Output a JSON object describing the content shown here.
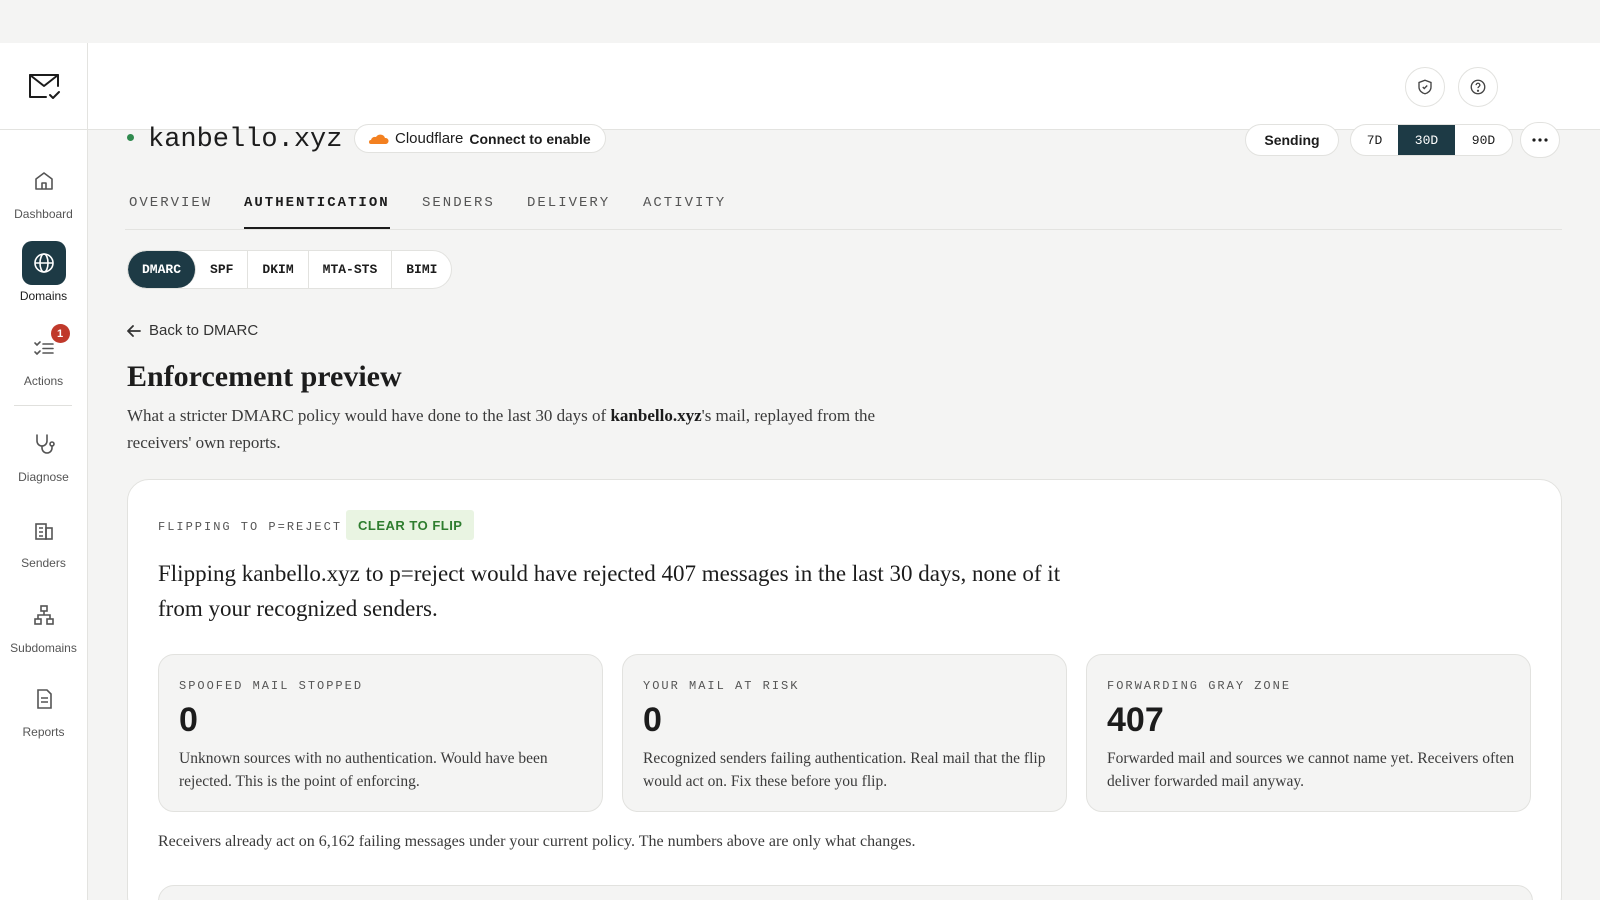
{
  "sidebar": {
    "items": [
      {
        "label": "Dashboard",
        "icon": "home-icon"
      },
      {
        "label": "Domains",
        "icon": "globe-icon"
      },
      {
        "label": "Actions",
        "icon": "checklist-icon",
        "badge": "1"
      },
      {
        "label": "Diagnose",
        "icon": "stethoscope-icon"
      },
      {
        "label": "Senders",
        "icon": "building-icon"
      },
      {
        "label": "Subdomains",
        "icon": "hierarchy-icon"
      },
      {
        "label": "Reports",
        "icon": "document-icon"
      }
    ],
    "active": "Domains"
  },
  "domain": {
    "name": "kanbello.xyz",
    "provider": "Cloudflare",
    "provider_cta": "Connect to enable",
    "status": "Sending",
    "ranges": [
      "7D",
      "30D",
      "90D"
    ],
    "active_range": "30D"
  },
  "tabs": [
    "OVERVIEW",
    "AUTHENTICATION",
    "SENDERS",
    "DELIVERY",
    "ACTIVITY"
  ],
  "active_tab": "AUTHENTICATION",
  "subtabs": [
    "DMARC",
    "SPF",
    "DKIM",
    "MTA-STS",
    "BIMI"
  ],
  "active_subtab": "DMARC",
  "page": {
    "back_label": "Back to DMARC",
    "title": "Enforcement preview",
    "intro_before": "What a stricter DMARC policy would have done to the last 30 days of ",
    "intro_domain": "kanbello.xyz",
    "intro_after": "'s mail, replayed from the receivers' own reports."
  },
  "preview": {
    "eyebrow": "FLIPPING TO P=REJECT",
    "badge": "CLEAR TO FLIP",
    "headline": "Flipping kanbello.xyz to p=reject would have rejected 407 messages in the last 30 days, none of it from your recognized senders.",
    "stats": [
      {
        "label": "SPOOFED MAIL STOPPED",
        "value": "0",
        "desc": "Unknown sources with no authentication. Would have been rejected. This is the point of enforcing."
      },
      {
        "label": "YOUR MAIL AT RISK",
        "value": "0",
        "desc": "Recognized senders failing authentication. Real mail that the flip would act on. Fix these before you flip."
      },
      {
        "label": "FORWARDING GRAY ZONE",
        "value": "407",
        "desc": "Forwarded mail and sources we cannot name yet. Receivers often deliver forwarded mail anyway."
      }
    ],
    "footnote": "Receivers already act on 6,162 failing messages under your current policy. The numbers above are only what changes."
  },
  "colors": {
    "accent": "#1d3a45",
    "status_green": "#2f8a4e",
    "badge_red": "#c0392b",
    "cloudflare": "#f38020"
  }
}
